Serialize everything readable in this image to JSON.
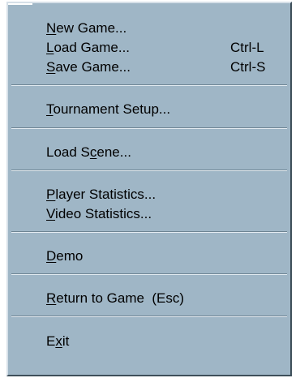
{
  "menu": {
    "items": [
      {
        "pre": "",
        "key": "N",
        "post": "ew Game...",
        "shortcut": ""
      },
      {
        "pre": "",
        "key": "L",
        "post": "oad Game...",
        "shortcut": "Ctrl-L"
      },
      {
        "pre": "",
        "key": "S",
        "post": "ave Game...",
        "shortcut": "Ctrl-S"
      },
      {
        "pre": "",
        "key": "T",
        "post": "ournament Setup...",
        "shortcut": ""
      },
      {
        "pre": "Load S",
        "key": "c",
        "post": "ene...",
        "shortcut": ""
      },
      {
        "pre": "",
        "key": "P",
        "post": "layer Statistics...",
        "shortcut": ""
      },
      {
        "pre": "",
        "key": "V",
        "post": "ideo Statistics...",
        "shortcut": ""
      },
      {
        "pre": "",
        "key": "D",
        "post": "emo",
        "shortcut": ""
      },
      {
        "pre": "",
        "key": "R",
        "post": "eturn to Game  (Esc)",
        "shortcut": ""
      },
      {
        "pre": "E",
        "key": "x",
        "post": "it",
        "shortcut": ""
      }
    ]
  }
}
